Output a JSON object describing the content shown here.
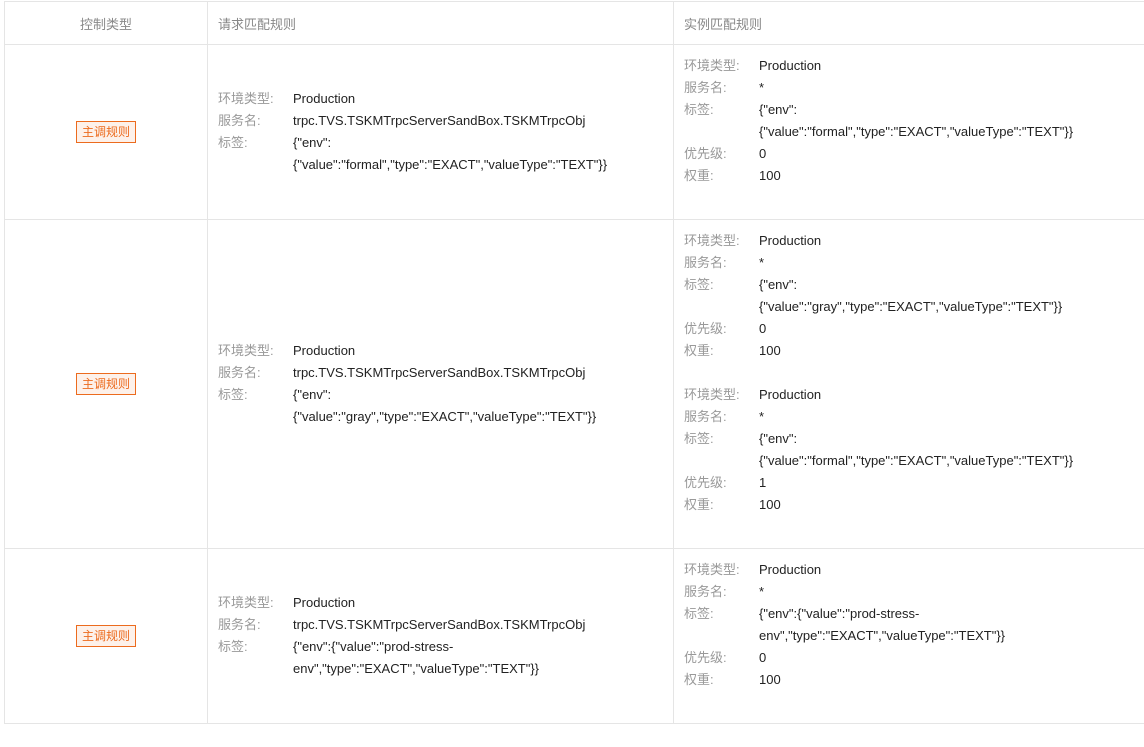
{
  "headers": {
    "control_type": "控制类型",
    "request_rule": "请求匹配规则",
    "instance_rule": "实例匹配规则"
  },
  "labels": {
    "env_type": "环境类型:",
    "service_name": "服务名:",
    "tags": "标签:",
    "priority": "优先级:",
    "weight": "权重:"
  },
  "rows": [
    {
      "badge": "主调规则",
      "request": {
        "env_type": "Production",
        "service_name": "trpc.TVS.TSKMTrpcServerSandBox.TSKMTrpcObj",
        "tags_line1": "{\"env\":",
        "tags_line2": "{\"value\":\"formal\",\"type\":\"EXACT\",\"valueType\":\"TEXT\"}}"
      },
      "instances": [
        {
          "env_type": "Production",
          "service_name": "*",
          "tags_line1": "{\"env\":",
          "tags_line2": "{\"value\":\"formal\",\"type\":\"EXACT\",\"valueType\":\"TEXT\"}}",
          "priority": "0",
          "weight": "100"
        }
      ]
    },
    {
      "badge": "主调规则",
      "request": {
        "env_type": "Production",
        "service_name": "trpc.TVS.TSKMTrpcServerSandBox.TSKMTrpcObj",
        "tags_line1": "{\"env\":",
        "tags_line2": "{\"value\":\"gray\",\"type\":\"EXACT\",\"valueType\":\"TEXT\"}}"
      },
      "instances": [
        {
          "env_type": "Production",
          "service_name": "*",
          "tags_line1": "{\"env\":",
          "tags_line2": "{\"value\":\"gray\",\"type\":\"EXACT\",\"valueType\":\"TEXT\"}}",
          "priority": "0",
          "weight": "100"
        },
        {
          "env_type": "Production",
          "service_name": "*",
          "tags_line1": "{\"env\":",
          "tags_line2": "{\"value\":\"formal\",\"type\":\"EXACT\",\"valueType\":\"TEXT\"}}",
          "priority": "1",
          "weight": "100"
        }
      ]
    },
    {
      "badge": "主调规则",
      "request": {
        "env_type": "Production",
        "service_name": "trpc.TVS.TSKMTrpcServerSandBox.TSKMTrpcObj",
        "tags_line1": "{\"env\":{\"value\":\"prod-stress-",
        "tags_line2": "env\",\"type\":\"EXACT\",\"valueType\":\"TEXT\"}}"
      },
      "instances": [
        {
          "env_type": "Production",
          "service_name": "*",
          "tags_line1": "{\"env\":{\"value\":\"prod-stress-",
          "tags_line2": "env\",\"type\":\"EXACT\",\"valueType\":\"TEXT\"}}",
          "priority": "0",
          "weight": "100"
        }
      ]
    }
  ]
}
